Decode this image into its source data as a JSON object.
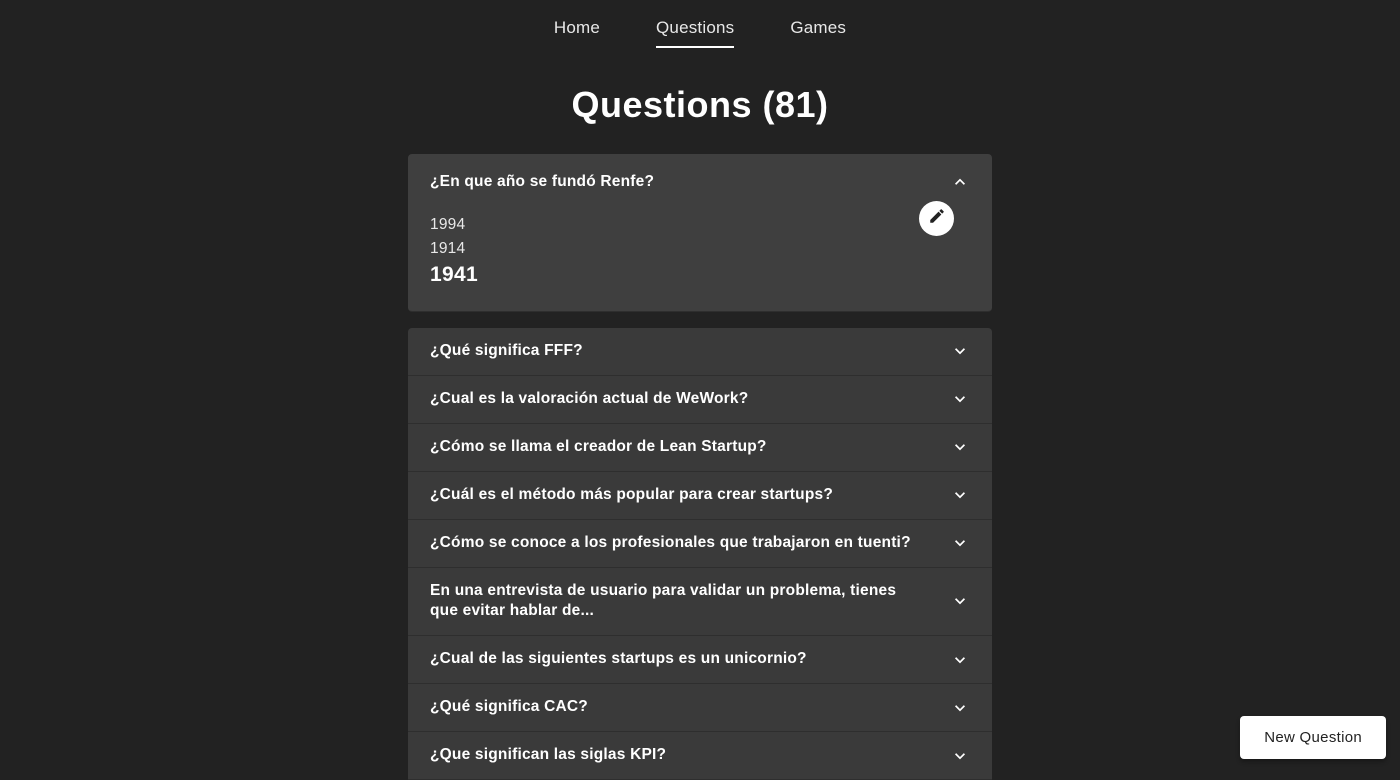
{
  "nav": {
    "home": "Home",
    "questions": "Questions",
    "games": "Games"
  },
  "page_title": "Questions (81)",
  "expanded_question": {
    "text": "¿En que año se fundó Renfe?",
    "options": [
      "1994",
      "1914"
    ],
    "correct": "1941"
  },
  "questions": [
    "¿Qué significa FFF?",
    "¿Cual es la valoración actual de WeWork?",
    "¿Cómo se llama el creador de Lean Startup?",
    "¿Cuál es el método más popular para crear startups?",
    "¿Cómo se conoce a los profesionales que trabajaron en tuenti?",
    "En una entrevista de usuario para validar un problema, tienes que evitar hablar de...",
    "¿Cual de las siguientes startups es un unicornio?",
    "¿Qué significa CAC?",
    "¿Que significan las siglas KPI?"
  ],
  "new_question_button": "New Question"
}
